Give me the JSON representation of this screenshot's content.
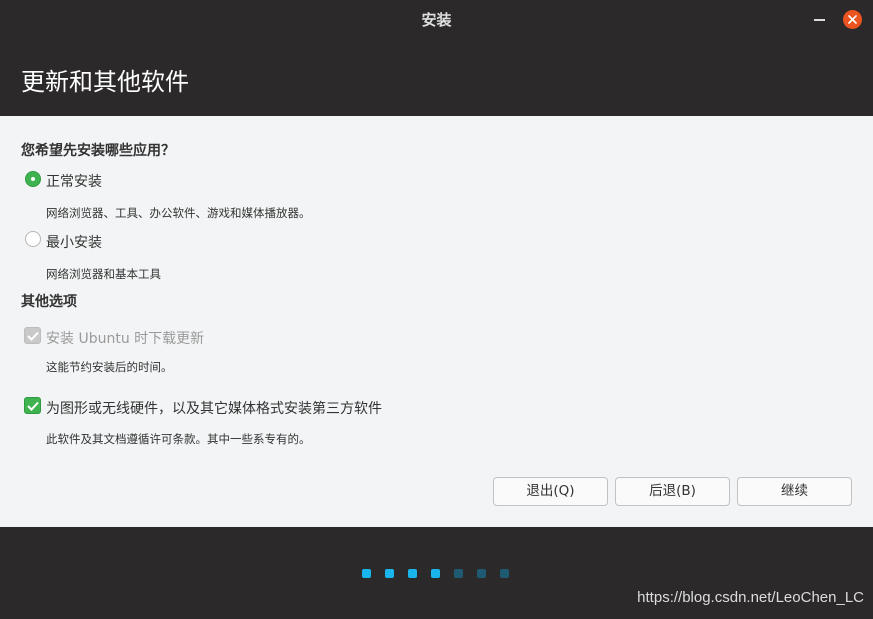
{
  "window": {
    "title": "安装"
  },
  "header": {
    "title": "更新和其他软件"
  },
  "install_type": {
    "question": "您希望先安装哪些应用？",
    "options": [
      {
        "label": "正常安装",
        "description": "网络浏览器、工具、办公软件、游戏和媒体播放器。",
        "selected": true
      },
      {
        "label": "最小安装",
        "description": "网络浏览器和基本工具",
        "selected": false
      }
    ]
  },
  "other_options": {
    "heading": "其他选项",
    "items": [
      {
        "label": "安装 Ubuntu 时下载更新",
        "description": "这能节约安装后的时间。",
        "checked": true,
        "enabled": false
      },
      {
        "label": "为图形或无线硬件，以及其它媒体格式安装第三方软件",
        "description": "此软件及其文档遵循许可条款。其中一些系专有的。",
        "checked": true,
        "enabled": true
      }
    ]
  },
  "buttons": {
    "quit": "退出(Q)",
    "back": "后退(B)",
    "continue": "继续"
  },
  "progress": {
    "total_steps": 7,
    "completed_steps": 4,
    "active_color": "#19b6ee",
    "inactive_color": "#1f5a73"
  },
  "colors": {
    "accent_green": "#3eb34f",
    "close_button": "#e95420"
  },
  "watermark": "https://blog.csdn.net/LeoChen_LC"
}
